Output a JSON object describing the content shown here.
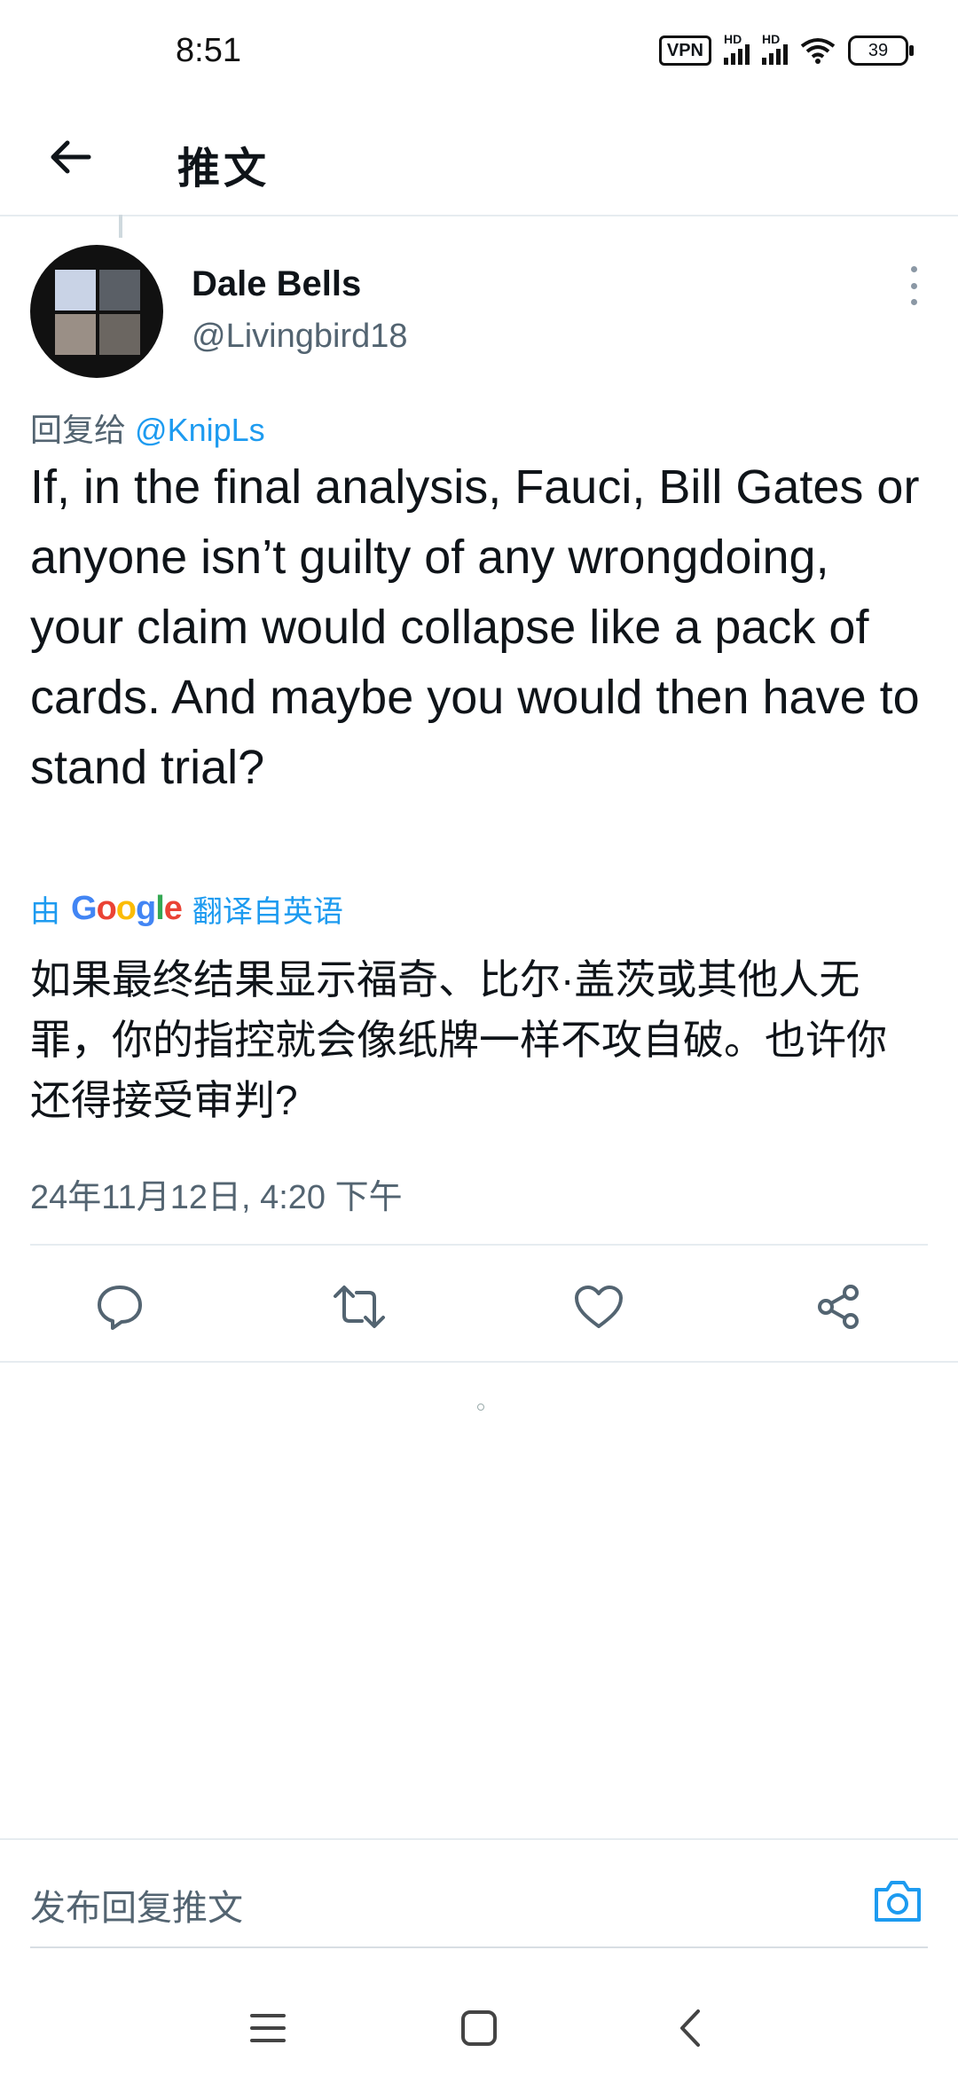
{
  "status_bar": {
    "time": "8:51",
    "vpn": "VPN",
    "hd": "HD",
    "battery": "39"
  },
  "header": {
    "title": "推文"
  },
  "tweet": {
    "author_name": "Dale Bells",
    "author_handle": "@Livingbird18",
    "reply_prefix": "回复给",
    "reply_mention": "@KnipLs",
    "text": "If, in the final analysis, Fauci, Bill Gates or anyone isn’t guilty of any wrongdoing, your claim would collapse like a pack of cards. And maybe you would then have to stand trial?",
    "translate_prefix": "由",
    "translate_service": "Google",
    "translate_suffix": "翻译自英语",
    "translated_text": "如果最终结果显示福奇、比尔·盖茨或其他人无罪，你的指控就会像纸牌一样不攻自破。也许你还得接受审判?",
    "timestamp": "24年11月12日, 4:20 下午"
  },
  "actions": [
    "reply-icon",
    "retweet-icon",
    "like-icon",
    "share-icon"
  ],
  "reply_bar": {
    "placeholder": "发布回复推文"
  },
  "colors": {
    "accent": "#1d9bf0",
    "text": "#0f1419",
    "secondary": "#536471",
    "divider": "#e6ecf0"
  }
}
